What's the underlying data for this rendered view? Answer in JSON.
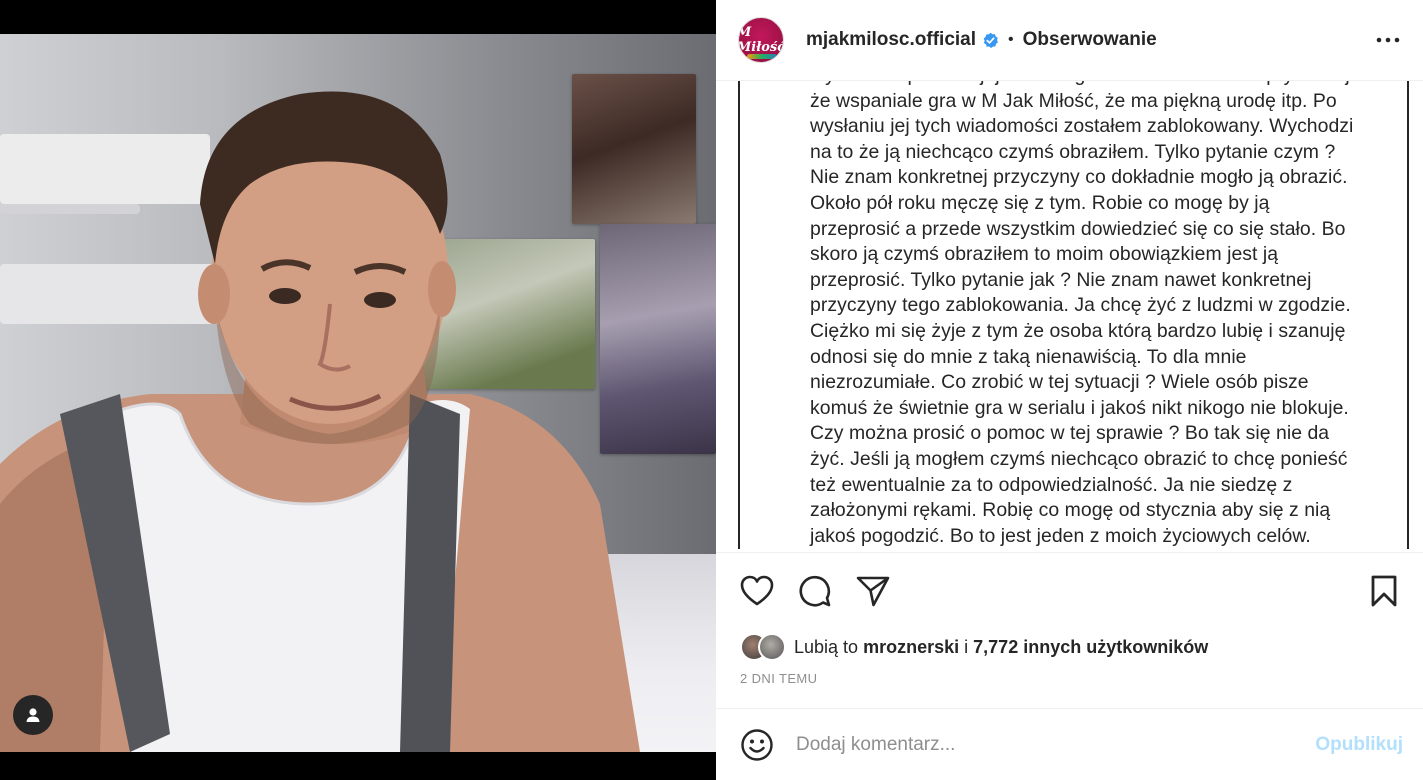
{
  "post": {
    "account": "mjakmilosc.official",
    "avatar_text": "M Miłość",
    "separator": "•",
    "follow_label": "Obserwowanie",
    "more_icon": "more-horizontal-icon"
  },
  "caption": {
    "lines": [
      "styczniu napisałem jej na Instagramie w wiadomości prywatnej",
      "że wspaniale gra w M Jak Miłość, że ma piękną urodę itp. Po",
      "wysłaniu jej tych wiadomości zostałem zablokowany. Wychodzi",
      "na to że ją niechcąco czymś obraziłem. Tylko pytanie czym ?",
      "Nie znam konkretnej przyczyny co dokładnie mogło ją obrazić.",
      "Około pół roku męczę się z tym. Robie co mogę by ją",
      "przeprosić a przede wszystkim dowiedzieć się co się stało. Bo",
      "skoro ją czymś obraziłem to moim obowiązkiem jest ją",
      "przeprosić. Tylko pytanie jak ? Nie znam nawet konkretnej",
      "przyczyny tego zablokowania. Ja chcę żyć z ludzmi w zgodzie.",
      "Ciężko mi się żyje z tym że osoba którą bardzo lubię i szanuję",
      "odnosi się do mnie z taką nienawiścią. To dla mnie",
      "niezrozumiałe. Co zrobić w tej sytuacji ? Wiele osób pisze",
      "komuś że świetnie gra w serialu i jakoś nikt nikogo nie blokuje.",
      "Czy można prosić o pomoc w tej sprawie ? Bo tak się nie da",
      "żyć. Jeśli ją mogłem czymś niechcąco obrazić to chcę ponieść",
      "też ewentualnie za to odpowiedzialność. Ja nie siedzę z",
      "założonymi rękami. Robię co mogę od stycznia aby się z nią",
      "jakoś pogodzić. Bo to jest jeden z moich życiowych celów."
    ]
  },
  "likes": {
    "prefix": "Lubią to",
    "user": "mroznerski",
    "connector": "i",
    "count_text": "7,772 innych użytkowników"
  },
  "timestamp": "2 DNI TEMU",
  "comment": {
    "placeholder": "Dodaj komentarz...",
    "publish_label": "Opublikuj"
  },
  "colors": {
    "text": "#262626",
    "muted": "#8e8e8e",
    "publish_disabled": "#b2dffc",
    "verified": "#3897f0"
  }
}
